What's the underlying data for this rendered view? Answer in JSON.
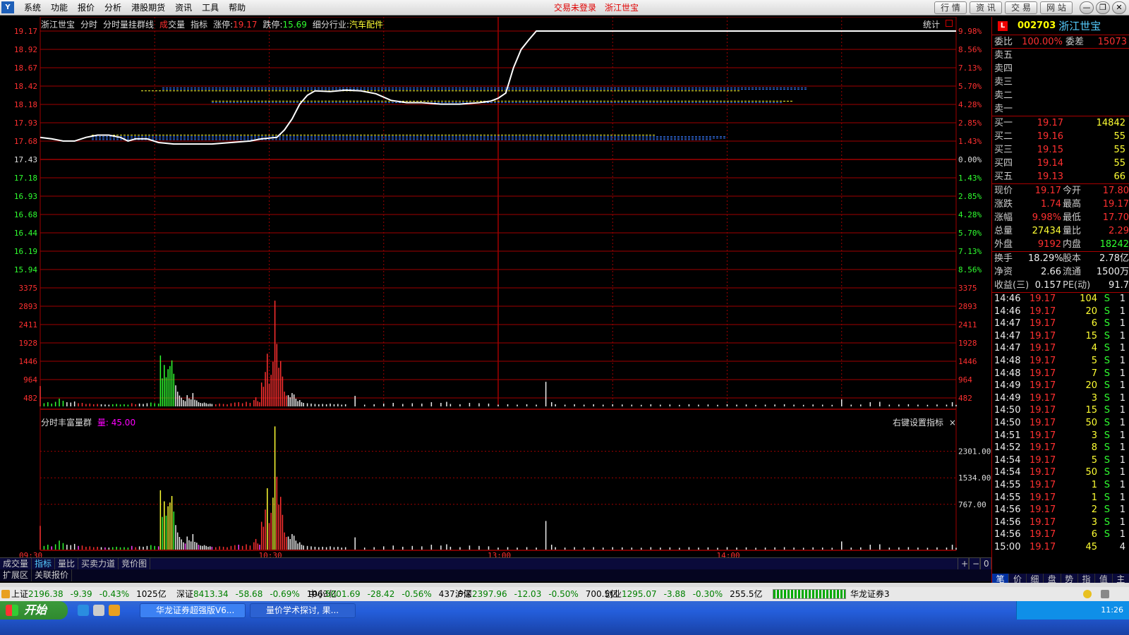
{
  "menubar": {
    "logo": "Y",
    "items": [
      "系统",
      "功能",
      "报价",
      "分析",
      "港股期货",
      "资讯",
      "工具",
      "帮助"
    ],
    "login_status": "交易未登录",
    "stock_name": "浙江世宝",
    "right_buttons": [
      "行 情",
      "资 讯",
      "交 易",
      "网 站"
    ],
    "window_controls": [
      "—",
      "❐",
      "✕"
    ]
  },
  "chart_header": {
    "name": "浙江世宝",
    "period": "分时",
    "indicator": "分时量挂群线",
    "vol_label_red": "成",
    "vol_label_rest": "交量",
    "index_label": "指标",
    "limit_up_label": "涨停:",
    "limit_up": "19.17",
    "limit_down_label": "跌停:",
    "limit_down": "15.69",
    "industry_label": "细分行业:",
    "industry": "汽车配件",
    "stats_label": "统计"
  },
  "chart_data": {
    "type": "line",
    "price_axis": [
      "19.17",
      "18.92",
      "18.67",
      "18.42",
      "18.18",
      "17.93",
      "17.68",
      "17.43",
      "17.18",
      "16.93",
      "16.68",
      "16.44",
      "16.19",
      "15.94"
    ],
    "pct_axis": [
      "9.98%",
      "8.56%",
      "7.13%",
      "5.70%",
      "4.28%",
      "2.85%",
      "1.43%",
      "0.00%",
      "1.43%",
      "2.85%",
      "4.28%",
      "5.70%",
      "7.13%",
      "8.56%"
    ],
    "prev_close": 17.43,
    "ylim": [
      15.69,
      19.17
    ],
    "volume_axis": [
      "3375",
      "2893",
      "2411",
      "1928",
      "1446",
      "964",
      "482"
    ],
    "time_axis": [
      "09:30",
      "10:30",
      "13:00",
      "14:00"
    ],
    "price_series": [
      [
        0,
        17.73
      ],
      [
        3,
        17.71
      ],
      [
        6,
        17.68
      ],
      [
        9,
        17.68
      ],
      [
        12,
        17.73
      ],
      [
        15,
        17.76
      ],
      [
        18,
        17.76
      ],
      [
        21,
        17.73
      ],
      [
        23,
        17.68
      ],
      [
        25,
        17.71
      ],
      [
        28,
        17.71
      ],
      [
        31,
        17.66
      ],
      [
        35,
        17.64
      ],
      [
        40,
        17.64
      ],
      [
        45,
        17.64
      ],
      [
        50,
        17.66
      ],
      [
        55,
        17.68
      ],
      [
        58,
        17.71
      ],
      [
        62,
        17.73
      ],
      [
        64,
        17.83
      ],
      [
        66,
        17.98
      ],
      [
        68,
        18.18
      ],
      [
        70,
        18.3
      ],
      [
        72,
        18.36
      ],
      [
        76,
        18.35
      ],
      [
        80,
        18.37
      ],
      [
        84,
        18.36
      ],
      [
        88,
        18.32
      ],
      [
        92,
        18.23
      ],
      [
        96,
        18.2
      ],
      [
        100,
        18.2
      ],
      [
        105,
        18.18
      ],
      [
        110,
        18.18
      ],
      [
        115,
        18.2
      ],
      [
        118,
        18.22
      ],
      [
        120,
        18.26
      ],
      [
        122,
        18.33
      ],
      [
        124,
        18.67
      ],
      [
        126,
        18.92
      ],
      [
        128,
        19.05
      ],
      [
        130,
        19.17
      ],
      [
        240,
        19.17
      ]
    ],
    "volume_series": [
      [
        0,
        580
      ],
      [
        2,
        90
      ],
      [
        4,
        120
      ],
      [
        6,
        80
      ],
      [
        8,
        130
      ],
      [
        10,
        220
      ],
      [
        12,
        160
      ],
      [
        14,
        120
      ],
      [
        16,
        110
      ],
      [
        18,
        140
      ],
      [
        20,
        90
      ],
      [
        22,
        100
      ],
      [
        24,
        70
      ],
      [
        26,
        80
      ],
      [
        28,
        60
      ],
      [
        30,
        70
      ],
      [
        32,
        60
      ],
      [
        34,
        55
      ],
      [
        36,
        50
      ],
      [
        38,
        60
      ],
      [
        40,
        70
      ],
      [
        42,
        55
      ],
      [
        44,
        60
      ],
      [
        46,
        50
      ],
      [
        48,
        90
      ],
      [
        50,
        60
      ],
      [
        52,
        80
      ],
      [
        54,
        70
      ],
      [
        56,
        90
      ],
      [
        58,
        110
      ],
      [
        60,
        90
      ],
      [
        62,
        80
      ],
      [
        63,
        1450
      ],
      [
        64,
        800
      ],
      [
        65,
        1180
      ],
      [
        66,
        830
      ],
      [
        67,
        1060
      ],
      [
        68,
        1150
      ],
      [
        69,
        1310
      ],
      [
        70,
        930
      ],
      [
        71,
        600
      ],
      [
        72,
        420
      ],
      [
        73,
        310
      ],
      [
        74,
        250
      ],
      [
        75,
        180
      ],
      [
        76,
        150
      ],
      [
        77,
        320
      ],
      [
        78,
        230
      ],
      [
        79,
        200
      ],
      [
        80,
        380
      ],
      [
        81,
        190
      ],
      [
        82,
        170
      ],
      [
        83,
        120
      ],
      [
        84,
        100
      ],
      [
        85,
        90
      ],
      [
        86,
        110
      ],
      [
        87,
        90
      ],
      [
        88,
        70
      ],
      [
        89,
        80
      ],
      [
        90,
        70
      ],
      [
        92,
        60
      ],
      [
        94,
        80
      ],
      [
        96,
        70
      ],
      [
        98,
        60
      ],
      [
        100,
        90
      ],
      [
        102,
        110
      ],
      [
        104,
        120
      ],
      [
        106,
        90
      ],
      [
        108,
        130
      ],
      [
        110,
        100
      ],
      [
        112,
        180
      ],
      [
        113,
        260
      ],
      [
        114,
        150
      ],
      [
        115,
        120
      ],
      [
        116,
        680
      ],
      [
        117,
        560
      ],
      [
        118,
        980
      ],
      [
        119,
        1500
      ],
      [
        120,
        650
      ],
      [
        121,
        900
      ],
      [
        122,
        1270
      ],
      [
        123,
        3010
      ],
      [
        124,
        1780
      ],
      [
        125,
        1100
      ],
      [
        126,
        1290
      ],
      [
        127,
        850
      ],
      [
        128,
        420
      ],
      [
        129,
        310
      ],
      [
        130,
        320
      ],
      [
        131,
        260
      ],
      [
        132,
        380
      ],
      [
        133,
        340
      ],
      [
        134,
        220
      ],
      [
        135,
        150
      ],
      [
        136,
        180
      ],
      [
        137,
        120
      ],
      [
        138,
        100
      ],
      [
        140,
        90
      ],
      [
        142,
        80
      ],
      [
        144,
        70
      ],
      [
        146,
        60
      ],
      [
        148,
        70
      ],
      [
        150,
        60
      ],
      [
        152,
        80
      ],
      [
        154,
        60
      ],
      [
        156,
        70
      ],
      [
        158,
        50
      ],
      [
        160,
        60
      ],
      [
        165,
        300
      ],
      [
        170,
        50
      ],
      [
        175,
        60
      ],
      [
        180,
        80
      ],
      [
        185,
        100
      ],
      [
        190,
        70
      ],
      [
        195,
        90
      ],
      [
        200,
        80
      ],
      [
        205,
        120
      ],
      [
        210,
        100
      ],
      [
        213,
        130
      ],
      [
        215,
        70
      ],
      [
        220,
        60
      ],
      [
        225,
        100
      ],
      [
        230,
        90
      ],
      [
        235,
        80
      ],
      [
        240,
        50
      ],
      [
        245,
        60
      ],
      [
        250,
        50
      ],
      [
        255,
        60
      ],
      [
        260,
        50
      ],
      [
        265,
        700
      ],
      [
        268,
        120
      ],
      [
        270,
        60
      ],
      [
        275,
        50
      ],
      [
        280,
        60
      ],
      [
        285,
        50
      ],
      [
        290,
        60
      ],
      [
        295,
        50
      ],
      [
        300,
        60
      ],
      [
        305,
        55
      ],
      [
        310,
        50
      ],
      [
        315,
        45
      ],
      [
        320,
        60
      ],
      [
        325,
        50
      ],
      [
        330,
        55
      ],
      [
        335,
        45
      ],
      [
        340,
        60
      ],
      [
        345,
        50
      ],
      [
        350,
        55
      ],
      [
        355,
        45
      ],
      [
        360,
        60
      ],
      [
        365,
        50
      ],
      [
        370,
        55
      ],
      [
        375,
        45
      ],
      [
        380,
        50
      ],
      [
        385,
        55
      ],
      [
        390,
        60
      ],
      [
        395,
        50
      ],
      [
        400,
        45
      ],
      [
        405,
        55
      ],
      [
        410,
        50
      ],
      [
        415,
        45
      ],
      [
        420,
        200
      ],
      [
        425,
        50
      ],
      [
        430,
        55
      ],
      [
        435,
        120
      ],
      [
        440,
        130
      ],
      [
        445,
        50
      ],
      [
        450,
        55
      ],
      [
        455,
        60
      ],
      [
        460,
        50
      ],
      [
        465,
        45
      ],
      [
        470,
        55
      ],
      [
        475,
        50
      ],
      [
        478,
        120
      ],
      [
        480,
        45
      ]
    ],
    "sub_indicator": {
      "name": "分时丰富量群",
      "value_label": "量:",
      "value": "45.00",
      "axis": [
        "2301.00",
        "1534.00",
        "767.00"
      ]
    }
  },
  "sub_panel": {
    "settings_hint": "右键设置指标",
    "close": "×"
  },
  "tabs_bottom": [
    "成交量",
    "指标",
    "量比",
    "买卖力道",
    "竞价图"
  ],
  "zoom_controls": [
    "+",
    "−",
    "0"
  ],
  "tabs_bottom2": [
    "扩展区",
    "关联报价"
  ],
  "right_panel": {
    "badge": "L",
    "code": "002703",
    "name": "浙江世宝",
    "weibi_label": "委比",
    "weibi": "100.00%",
    "weicha_label": "委差",
    "weicha": "15073",
    "sell": [
      {
        "label": "卖五",
        "price": "",
        "vol": ""
      },
      {
        "label": "卖四",
        "price": "",
        "vol": ""
      },
      {
        "label": "卖三",
        "price": "",
        "vol": ""
      },
      {
        "label": "卖二",
        "price": "",
        "vol": ""
      },
      {
        "label": "卖一",
        "price": "",
        "vol": ""
      }
    ],
    "buy": [
      {
        "label": "买一",
        "price": "19.17",
        "vol": "14842"
      },
      {
        "label": "买二",
        "price": "19.16",
        "vol": "55"
      },
      {
        "label": "买三",
        "price": "19.15",
        "vol": "55"
      },
      {
        "label": "买四",
        "price": "19.14",
        "vol": "55"
      },
      {
        "label": "买五",
        "price": "19.13",
        "vol": "66"
      }
    ],
    "quote": [
      {
        "k1": "现价",
        "v1": "19.17",
        "c1": "red",
        "k2": "今开",
        "v2": "17.80",
        "c2": "red"
      },
      {
        "k1": "涨跌",
        "v1": "1.74",
        "c1": "red",
        "k2": "最高",
        "v2": "19.17",
        "c2": "red"
      },
      {
        "k1": "涨幅",
        "v1": "9.98%",
        "c1": "red",
        "k2": "最低",
        "v2": "17.70",
        "c2": "red"
      },
      {
        "k1": "总量",
        "v1": "27434",
        "c1": "yellow",
        "k2": "量比",
        "v2": "2.29",
        "c2": "red"
      },
      {
        "k1": "外盘",
        "v1": "9192",
        "c1": "red",
        "k2": "内盘",
        "v2": "18242",
        "c2": "green"
      }
    ],
    "fund": [
      {
        "k1": "换手",
        "v1": "18.29%",
        "k2": "股本",
        "v2": "2.78亿"
      },
      {
        "k1": "净资",
        "v1": "2.66",
        "k2": "流通",
        "v2": "1500万"
      },
      {
        "k1": "收益(三)",
        "v1": "0.157",
        "k2": "PE(动)",
        "v2": "91.7"
      }
    ],
    "trades": [
      {
        "t": "14:46",
        "p": "19.17",
        "v": "104",
        "s": "S",
        "n": "1"
      },
      {
        "t": "14:46",
        "p": "19.17",
        "v": "20",
        "s": "S",
        "n": "1"
      },
      {
        "t": "14:47",
        "p": "19.17",
        "v": "6",
        "s": "S",
        "n": "1"
      },
      {
        "t": "14:47",
        "p": "19.17",
        "v": "15",
        "s": "S",
        "n": "1"
      },
      {
        "t": "14:47",
        "p": "19.17",
        "v": "4",
        "s": "S",
        "n": "1"
      },
      {
        "t": "14:48",
        "p": "19.17",
        "v": "5",
        "s": "S",
        "n": "1"
      },
      {
        "t": "14:48",
        "p": "19.17",
        "v": "7",
        "s": "S",
        "n": "1"
      },
      {
        "t": "14:49",
        "p": "19.17",
        "v": "20",
        "s": "S",
        "n": "1"
      },
      {
        "t": "14:49",
        "p": "19.17",
        "v": "3",
        "s": "S",
        "n": "1"
      },
      {
        "t": "14:50",
        "p": "19.17",
        "v": "15",
        "s": "S",
        "n": "1"
      },
      {
        "t": "14:50",
        "p": "19.17",
        "v": "50",
        "s": "S",
        "n": "1"
      },
      {
        "t": "14:51",
        "p": "19.17",
        "v": "3",
        "s": "S",
        "n": "1"
      },
      {
        "t": "14:52",
        "p": "19.17",
        "v": "8",
        "s": "S",
        "n": "1"
      },
      {
        "t": "14:54",
        "p": "19.17",
        "v": "5",
        "s": "S",
        "n": "1"
      },
      {
        "t": "14:54",
        "p": "19.17",
        "v": "50",
        "s": "S",
        "n": "1"
      },
      {
        "t": "14:55",
        "p": "19.17",
        "v": "1",
        "s": "S",
        "n": "1"
      },
      {
        "t": "14:55",
        "p": "19.17",
        "v": "1",
        "s": "S",
        "n": "1"
      },
      {
        "t": "14:56",
        "p": "19.17",
        "v": "2",
        "s": "S",
        "n": "1"
      },
      {
        "t": "14:56",
        "p": "19.17",
        "v": "3",
        "s": "S",
        "n": "1"
      },
      {
        "t": "14:56",
        "p": "19.17",
        "v": "6",
        "s": "S",
        "n": "1"
      },
      {
        "t": "15:00",
        "p": "19.17",
        "v": "45",
        "s": "",
        "n": "4"
      }
    ],
    "tabs": [
      "笔",
      "价",
      "细",
      "盘",
      "势",
      "指",
      "值",
      "主"
    ]
  },
  "status_bar": {
    "indices": [
      {
        "name": "上证",
        "value": "2196.38",
        "chg": "-9.39",
        "pct": "-0.43%",
        "amt": "1025亿"
      },
      {
        "name": "深证",
        "value": "8413.34",
        "chg": "-58.68",
        "pct": "-0.69%",
        "amt": "1063亿"
      },
      {
        "name": "中小",
        "value": "5001.69",
        "chg": "-28.42",
        "pct": "-0.56%",
        "amt": "437.6亿"
      },
      {
        "name": "沪深",
        "value": "2397.96",
        "chg": "-12.03",
        "pct": "-0.50%",
        "amt": "700.5亿"
      },
      {
        "name": "创业",
        "value": "1295.07",
        "chg": "-3.88",
        "pct": "-0.30%",
        "amt": "255.5亿"
      }
    ],
    "broker": "华龙证券3"
  },
  "taskbar": {
    "start": "开始",
    "tasks": [
      "华龙证券超强版V6...",
      "量价学术探讨, 果..."
    ],
    "clock": "11:26"
  },
  "colors": {
    "up": "#ff3030",
    "down": "#30ff30",
    "grid": "#a00000",
    "price_line": "#ffffff"
  }
}
